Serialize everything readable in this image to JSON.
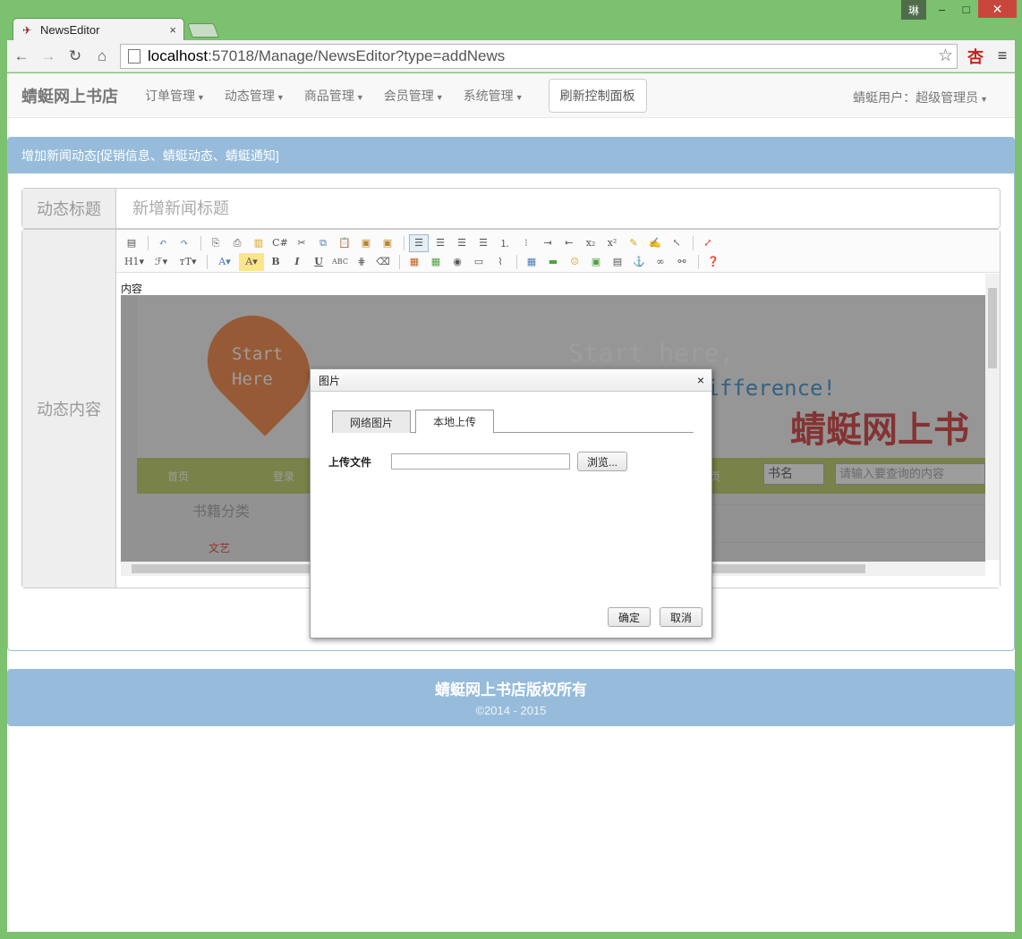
{
  "window": {
    "user_badge": "琳",
    "minimize": "–",
    "maximize": "□",
    "close": "✕"
  },
  "browser": {
    "tab_title": "NewsEditor",
    "tab_close": "×",
    "url_host": "localhost",
    "url_rest": ":57018/Manage/NewsEditor?type=addNews",
    "ext_badge": "杏"
  },
  "navbar": {
    "brand": "蜻蜓网上书店",
    "items": [
      {
        "label": "订单管理"
      },
      {
        "label": "动态管理"
      },
      {
        "label": "商品管理"
      },
      {
        "label": "会员管理"
      },
      {
        "label": "系统管理"
      }
    ],
    "refresh": "刷新控制面板",
    "user": "蜻蜓用户：超级管理员"
  },
  "panel": {
    "heading": "增加新闻动态[促销信息、蜻蜓动态、蜻蜓通知]",
    "title_label": "动态标题",
    "title_placeholder": "新增新闻标题",
    "content_label": "动态内容"
  },
  "editor": {
    "content_text": "内容",
    "toolbar_row1": [
      "source-icon",
      "undo-icon",
      "redo-icon",
      "preview-icon",
      "print-icon",
      "template-icon",
      "code-icon",
      "cut-icon",
      "copy-icon",
      "paste-icon",
      "paste-text-icon",
      "paste-word-icon",
      "align-left-icon",
      "align-center-icon",
      "align-right-icon",
      "align-justify-icon",
      "ordered-list-icon",
      "unordered-list-icon",
      "indent-icon",
      "outdent-icon",
      "subscript-icon",
      "superscript-icon",
      "clear-format-icon",
      "spellcheck-icon",
      "select-all-icon",
      "fullscreen-icon"
    ],
    "toolbar_row2_labels": {
      "heading": "H1",
      "font": "ℱ",
      "size": "тT",
      "forecolor": "A",
      "bgcolor": "A",
      "bold": "B",
      "italic": "I",
      "underline": "U",
      "strike": "ABC",
      "hr": "⋕",
      "eraser": "⌫"
    },
    "embedded_screenshot": {
      "pin_text": "Start\nHere",
      "slogan": "Start here,",
      "slogan2": "difference!",
      "logo": "蜻蜓网上书",
      "nav_items": [
        "首页",
        "登录"
      ],
      "nav_right": "页",
      "select_value": "书名",
      "search_placeholder": "请输入要查询的内容",
      "category_title": "书籍分类",
      "category_item": "文艺"
    }
  },
  "footer": {
    "title": "蜻蜓网上书店版权所有",
    "copyright": "©2014 - 2015"
  },
  "dialog": {
    "title": "图片",
    "close": "×",
    "tabs": [
      {
        "label": "网络图片",
        "active": false
      },
      {
        "label": "本地上传",
        "active": true
      }
    ],
    "upload_label": "上传文件",
    "browse": "浏览...",
    "ok": "确定",
    "cancel": "取消"
  },
  "colors": {
    "window_frame": "#7bc16f",
    "panel_header": "#97bcdb",
    "close_red": "#c9463d"
  }
}
